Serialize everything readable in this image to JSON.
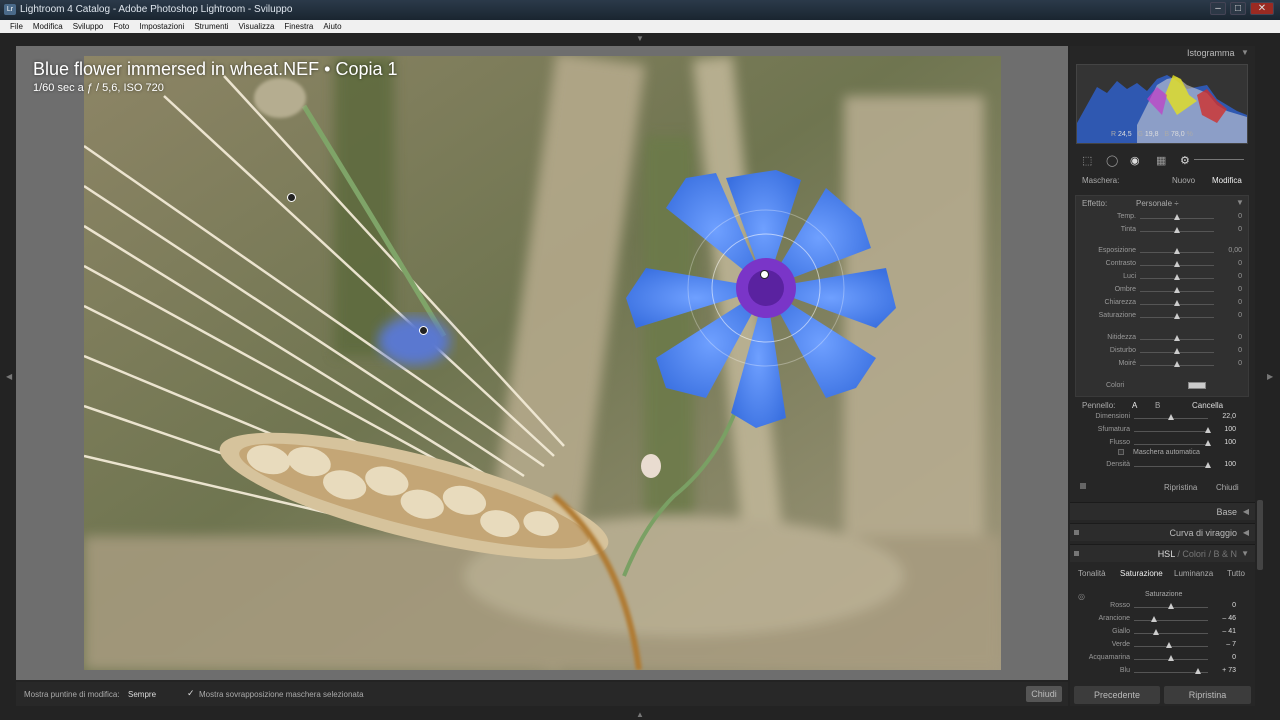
{
  "window": {
    "title": "Lightroom 4 Catalog - Adobe Photoshop Lightroom - Sviluppo",
    "app_badge": "Lr",
    "controls": [
      "–",
      "□",
      "✕"
    ]
  },
  "menu": [
    "File",
    "Modifica",
    "Sviluppo",
    "Foto",
    "Impostazioni",
    "Strumenti",
    "Visualizza",
    "Finestra",
    "Aiuto"
  ],
  "photo": {
    "title": "Blue flower immersed in wheat.NEF",
    "separator": "•",
    "copy": "Copia 1",
    "exif": "1/60 sec a ƒ / 5,6, ISO 720"
  },
  "bottom_toolbar": {
    "show_pins_label": "Mostra puntine di modifica:",
    "show_pins_value": "Sempre",
    "check_mark": "✓",
    "overlay_label": "Mostra sovrapposizione maschera selezionata",
    "close_button": "Chiudi"
  },
  "histogram": {
    "title": "Istogramma",
    "r_label": "R",
    "r_value": "24,5",
    "g_label": "G",
    "g_value": "19,8",
    "b_label": "B",
    "b_value": "78,0",
    "percent": "%"
  },
  "mask": {
    "label": "Maschera:",
    "new": "Nuovo",
    "edit": "Modifica"
  },
  "effect": {
    "label": "Effetto:",
    "preset": "Personale",
    "preset_arrows": "÷",
    "sliders": [
      {
        "name": "Temp.",
        "value": "0",
        "pos": 0.5
      },
      {
        "name": "Tinta",
        "value": "0",
        "pos": 0.5
      },
      {
        "name": "Esposizione",
        "value": "0,00",
        "pos": 0.5
      },
      {
        "name": "Contrasto",
        "value": "0",
        "pos": 0.5
      },
      {
        "name": "Luci",
        "value": "0",
        "pos": 0.5
      },
      {
        "name": "Ombre",
        "value": "0",
        "pos": 0.5
      },
      {
        "name": "Chiarezza",
        "value": "0",
        "pos": 0.5
      },
      {
        "name": "Saturazione",
        "value": "0",
        "pos": 0.5
      },
      {
        "name": "Nitidezza",
        "value": "0",
        "pos": 0.5
      },
      {
        "name": "Disturbo",
        "value": "0",
        "pos": 0.5
      },
      {
        "name": "Moiré",
        "value": "0",
        "pos": 0.5
      }
    ],
    "color_label": "Colori"
  },
  "brush": {
    "label": "Pennello:",
    "a": "A",
    "b": "B",
    "erase": "Cancella",
    "sliders": [
      {
        "name": "Dimensioni",
        "value": "22,0",
        "pos": 0.5
      },
      {
        "name": "Sfumatura",
        "value": "100",
        "pos": 1.0
      },
      {
        "name": "Flusso",
        "value": "100",
        "pos": 1.0
      }
    ],
    "auto_mask": "Maschera automatica",
    "density": {
      "name": "Densità",
      "value": "100",
      "pos": 1.0
    },
    "reset": "Ripristina",
    "close": "Chiudi"
  },
  "sections": {
    "base": "Base",
    "tone_curve": "Curva di viraggio",
    "hsl": "HSL",
    "hsl_sep": "/",
    "colors": "Colori",
    "bw": "B & N"
  },
  "hsl_tabs": [
    "Tonalità",
    "Saturazione",
    "Luminanza",
    "Tutto"
  ],
  "saturation": {
    "title": "Saturazione",
    "sliders": [
      {
        "name": "Rosso",
        "value": "0",
        "pos": 0.5
      },
      {
        "name": "Arancione",
        "value": "– 46",
        "pos": 0.27
      },
      {
        "name": "Giallo",
        "value": "– 41",
        "pos": 0.3
      },
      {
        "name": "Verde",
        "value": "– 7",
        "pos": 0.47
      },
      {
        "name": "Acquamarina",
        "value": "0",
        "pos": 0.5
      },
      {
        "name": "Blu",
        "value": "+ 73",
        "pos": 0.86
      }
    ]
  },
  "footer": {
    "previous": "Precedente",
    "reset": "Ripristina"
  },
  "colors": {
    "panel_bg": "#262626",
    "canvas_bg": "#6e6e6e",
    "flower_blue": "#4a7fe8",
    "flower_center": "#7a35c8"
  }
}
